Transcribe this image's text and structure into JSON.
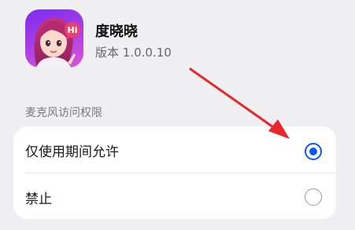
{
  "app": {
    "name": "度晓晓",
    "version": "版本 1.0.0.10",
    "icon_name": "duxiaoxiao-app-icon",
    "icon_badge_text": "Hi"
  },
  "permission": {
    "section_title": "麦克风访问权限",
    "options": [
      {
        "label": "仅使用期间允许",
        "selected": true
      },
      {
        "label": "禁止",
        "selected": false
      }
    ]
  },
  "colors": {
    "accent": "#0a59f7",
    "annotation_arrow": "#e8262b",
    "background": "#f0f0f2",
    "card": "#ffffff"
  }
}
